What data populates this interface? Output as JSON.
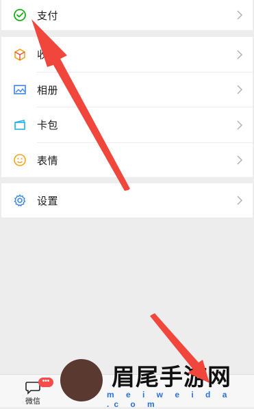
{
  "menu": {
    "pay": {
      "label": "支付",
      "icon": "wechat-pay-icon"
    },
    "items": [
      {
        "label": "收藏",
        "icon": "favorites-cube-icon"
      },
      {
        "label": "相册",
        "icon": "album-icon"
      },
      {
        "label": "卡包",
        "icon": "card-wallet-icon"
      },
      {
        "label": "表情",
        "icon": "emoji-smile-icon"
      }
    ],
    "settings": {
      "label": "设置",
      "icon": "gear-icon"
    }
  },
  "bottom_bar": {
    "wechat_tab": {
      "label": "微信",
      "badge": "•••"
    }
  },
  "watermark": {
    "title": "眉尾手游网",
    "subtitle": "m e i w e i d a .c o m"
  },
  "colors": {
    "accent_green": "#1aad19",
    "arrow_red": "#f0463c",
    "badge_red": "#f74c4c"
  }
}
